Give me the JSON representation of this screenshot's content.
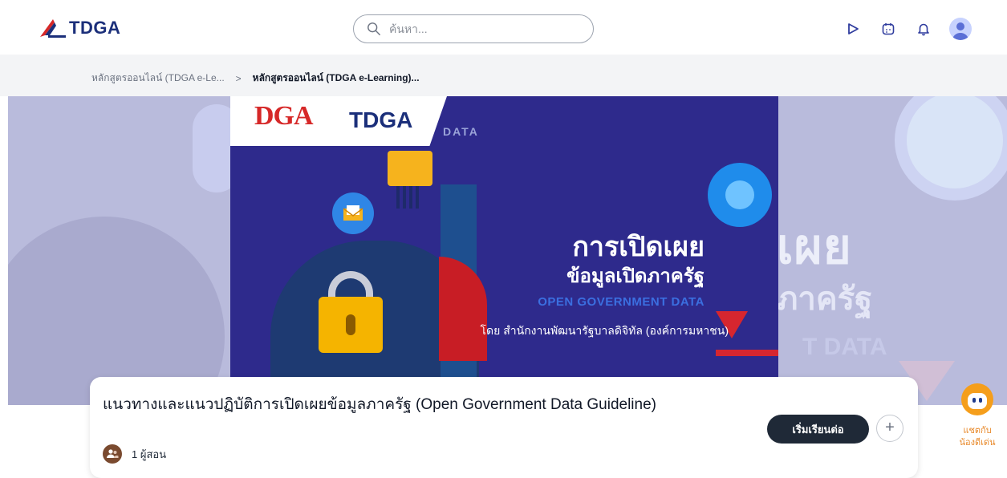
{
  "header": {
    "logo_text": "TDGA",
    "search_placeholder": "ค้นหา..."
  },
  "breadcrumb": {
    "items": [
      {
        "label": "หลักสูตรออนไลน์ (TDGA e-Le..."
      },
      {
        "label": "หลักสูตรออนไลน์ (TDGA e-Learning)..."
      }
    ],
    "separator": ">"
  },
  "banner": {
    "dga": "DGA",
    "tdga": "TDGA",
    "tag": "DATA",
    "title_line1": "การเปิดเผย",
    "title_line2": "ข้อมูลเปิดภาครัฐ",
    "title_en": "OPEN GOVERNMENT DATA",
    "by_line": "โดย  สำนักงานพัฒนารัฐบาลดิจิทัล (องค์การมหาชน)"
  },
  "hero_bg": {
    "text1": "เผย",
    "text2": "ภาครัฐ",
    "text3": "T DATA"
  },
  "course": {
    "title": "แนวทางและแนวปฏิบัติการเปิดเผยข้อมูลภาครัฐ (Open Government Data Guideline)",
    "instructors": "1 ผู้สอน",
    "start_label": "เริ่มเรียนต่อ",
    "add_label": "+"
  },
  "chatbot": {
    "label_line1": "แชตกับ",
    "label_line2": "น้องดีเด่น"
  },
  "colors": {
    "brand_navy": "#1b2f7a",
    "banner_bg": "#2e2a8c",
    "accent_orange": "#e8892a"
  }
}
